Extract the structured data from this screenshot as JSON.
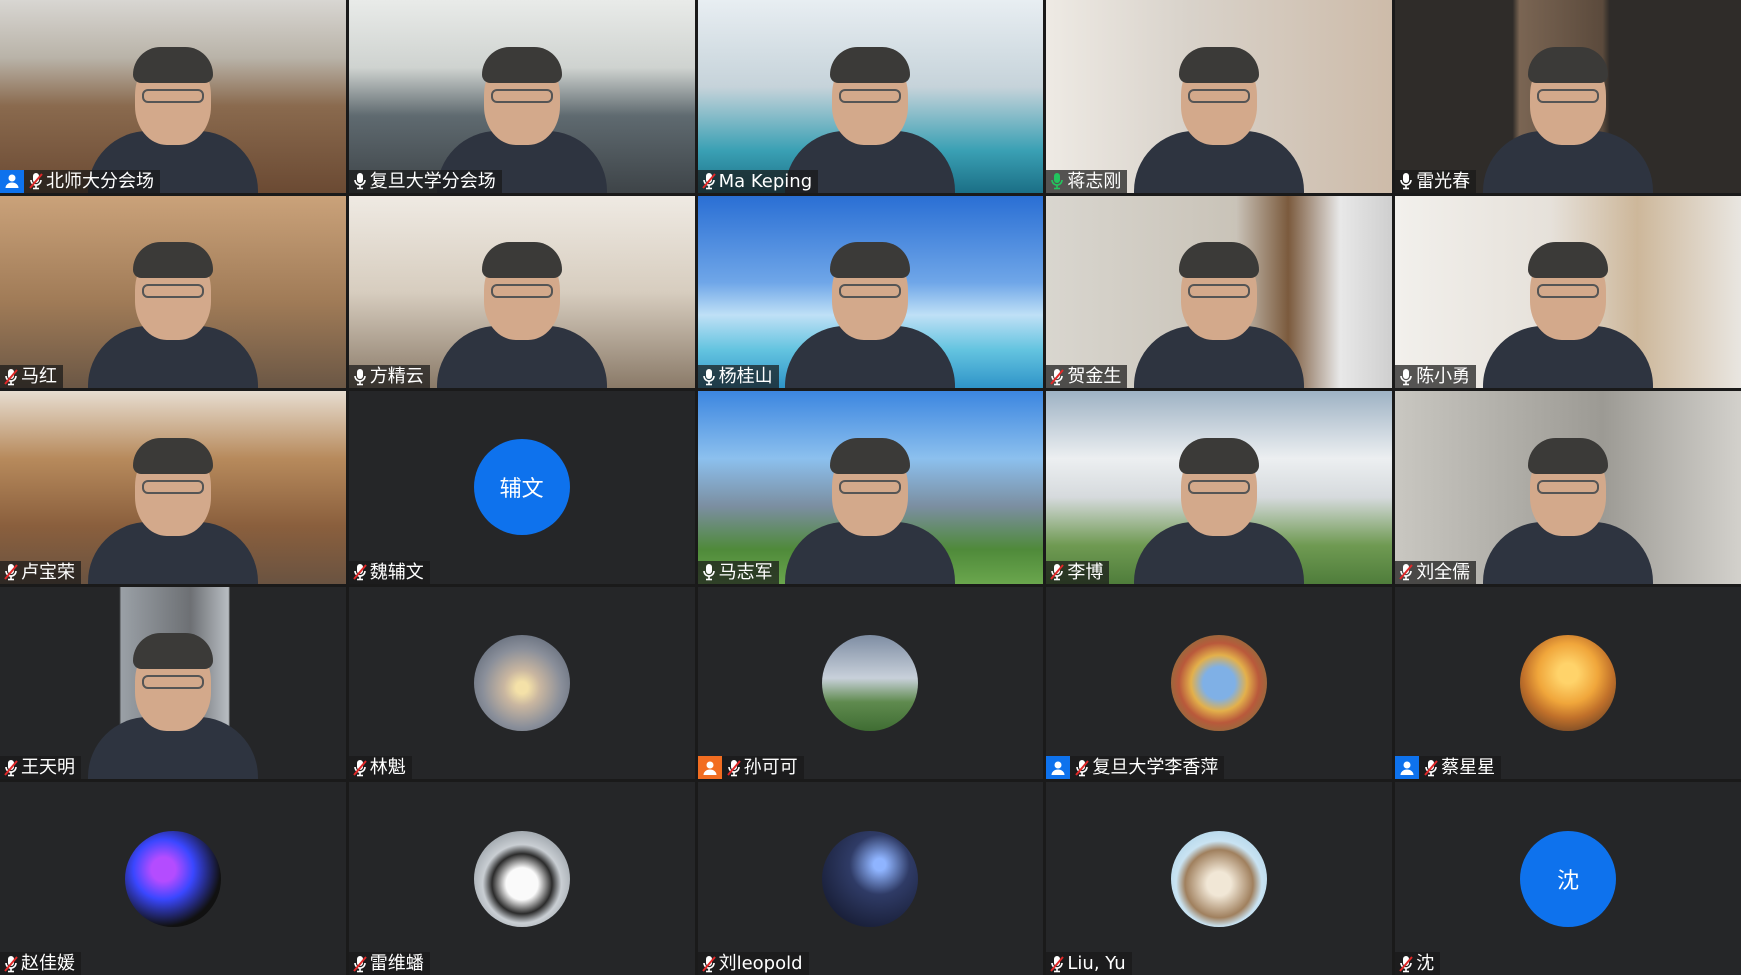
{
  "tiles": [
    {
      "name": "北师大分会场",
      "type": "video",
      "bg": "meeting-room",
      "badge": "blue",
      "mic": "muted"
    },
    {
      "name": "复旦大学分会场",
      "type": "video",
      "bg": "classroom",
      "badge": "none",
      "mic": "on"
    },
    {
      "name": "Ma Keping",
      "type": "video",
      "bg": "snowforest",
      "badge": "none",
      "mic": "muted"
    },
    {
      "name": "蒋志刚",
      "type": "video",
      "bg": "painting",
      "badge": "none",
      "mic": "speaking"
    },
    {
      "name": "雷光春",
      "type": "video",
      "bg": "bookshelf-dark",
      "badge": "none",
      "mic": "on"
    },
    {
      "name": "马红",
      "type": "video",
      "bg": "warm-room",
      "badge": "none",
      "mic": "muted"
    },
    {
      "name": "方精云",
      "type": "video",
      "bg": "shelves",
      "badge": "none",
      "mic": "on"
    },
    {
      "name": "杨桂山",
      "type": "video",
      "bg": "sky-sea",
      "badge": "none",
      "mic": "on"
    },
    {
      "name": "贺金生",
      "type": "video",
      "bg": "balcony",
      "badge": "none",
      "mic": "muted"
    },
    {
      "name": "陈小勇",
      "type": "video",
      "bg": "window-room",
      "badge": "none",
      "mic": "on"
    },
    {
      "name": "卢宝荣",
      "type": "video",
      "bg": "library",
      "badge": "none",
      "mic": "muted"
    },
    {
      "name": "魏辅文",
      "type": "avatar-text",
      "avatar_text": "辅文",
      "badge": "none",
      "mic": "muted"
    },
    {
      "name": "马志军",
      "type": "video",
      "bg": "tower",
      "badge": "none",
      "mic": "on"
    },
    {
      "name": "李博",
      "type": "video",
      "bg": "snowfield",
      "badge": "none",
      "mic": "muted"
    },
    {
      "name": "刘全儒",
      "type": "video",
      "bg": "grey-room",
      "badge": "none",
      "mic": "muted"
    },
    {
      "name": "王天明",
      "type": "video",
      "bg": "car",
      "badge": "none",
      "mic": "muted"
    },
    {
      "name": "林魁",
      "type": "avatar-img",
      "avatar": "sunset-tree",
      "badge": "none",
      "mic": "muted"
    },
    {
      "name": "孙可可",
      "type": "avatar-img",
      "avatar": "runner",
      "badge": "orange",
      "mic": "muted"
    },
    {
      "name": "复旦大学李香萍",
      "type": "avatar-img",
      "avatar": "leaves",
      "badge": "blue",
      "mic": "muted"
    },
    {
      "name": "蔡星星",
      "type": "avatar-img",
      "avatar": "beach",
      "badge": "blue",
      "mic": "muted"
    },
    {
      "name": "赵佳媛",
      "type": "avatar-img",
      "avatar": "neon",
      "badge": "none",
      "mic": "muted"
    },
    {
      "name": "雷维蟠",
      "type": "avatar-img",
      "avatar": "penguin",
      "badge": "none",
      "mic": "muted"
    },
    {
      "name": "刘leopold",
      "type": "avatar-img",
      "avatar": "night",
      "badge": "none",
      "mic": "muted"
    },
    {
      "name": "Liu, Yu",
      "type": "avatar-img",
      "avatar": "squirrel",
      "badge": "none",
      "mic": "muted"
    },
    {
      "name": "沈",
      "type": "avatar-text",
      "avatar_text": "沈",
      "badge": "none",
      "mic": "muted"
    }
  ],
  "colors": {
    "tile_bg": "#252628",
    "gap": "#1a1a1a",
    "avatar_blue": "#0e72ed",
    "host_orange": "#f26d21",
    "mic_muted": "#e02828",
    "mic_speaking": "#22c55e"
  }
}
